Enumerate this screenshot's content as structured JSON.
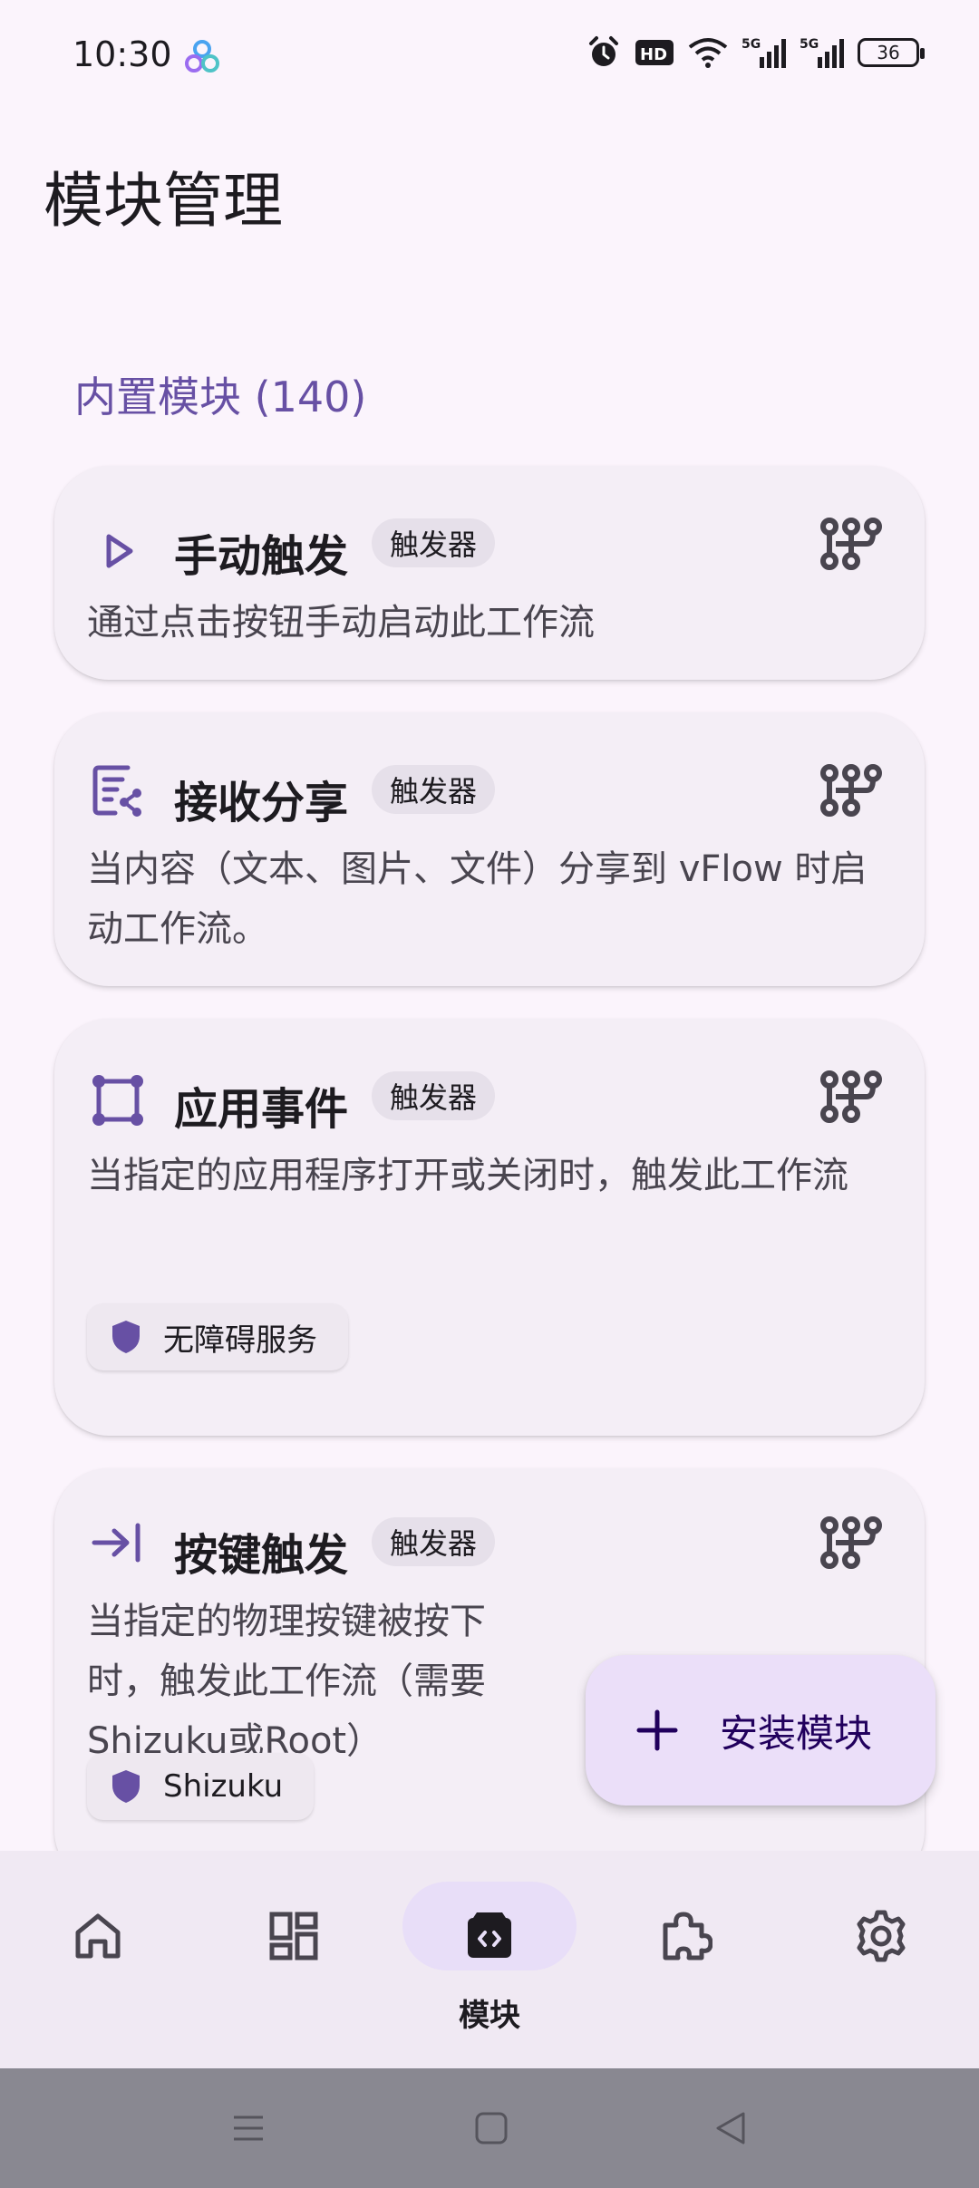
{
  "status_bar": {
    "time": "10:30",
    "battery": "36",
    "icons": [
      "alarm-icon",
      "hd-icon",
      "wifi-icon",
      "signal-5g-icon",
      "signal-5g-icon",
      "battery-icon"
    ]
  },
  "page": {
    "title": "模块管理",
    "section_header": "内置模块 (140)"
  },
  "modules": [
    {
      "icon": "play-icon",
      "name": "手动触发",
      "tag": "触发器",
      "description": "通过点击按钮手动启动此工作流"
    },
    {
      "icon": "share-receive-icon",
      "name": "接收分享",
      "tag": "触发器",
      "description": "当内容（文本、图片、文件）分享到 vFlow 时启动工作流。"
    },
    {
      "icon": "app-frame-icon",
      "name": "应用事件",
      "tag": "触发器",
      "description": "当指定的应用程序打开或关闭时，触发此工作流",
      "permission": "无障碍服务"
    },
    {
      "icon": "key-input-icon",
      "name": "按键触发",
      "tag": "触发器",
      "description": "当指定的物理按键被按下时，触发此工作流（需要Shizuku或Root）",
      "permission": "Shizuku"
    }
  ],
  "fab": {
    "label": "安装模块",
    "icon": "plus-icon"
  },
  "bottom_nav": {
    "items": [
      {
        "icon": "home-icon",
        "label": ""
      },
      {
        "icon": "dashboard-icon",
        "label": ""
      },
      {
        "icon": "module-icon",
        "label": "模块",
        "active": true
      },
      {
        "icon": "puzzle-icon",
        "label": ""
      },
      {
        "icon": "settings-icon",
        "label": ""
      }
    ]
  },
  "colors": {
    "background": "#fbf4fc",
    "primary": "#6750a4",
    "card": "#f4eef6",
    "fab": "#ebdff9"
  }
}
